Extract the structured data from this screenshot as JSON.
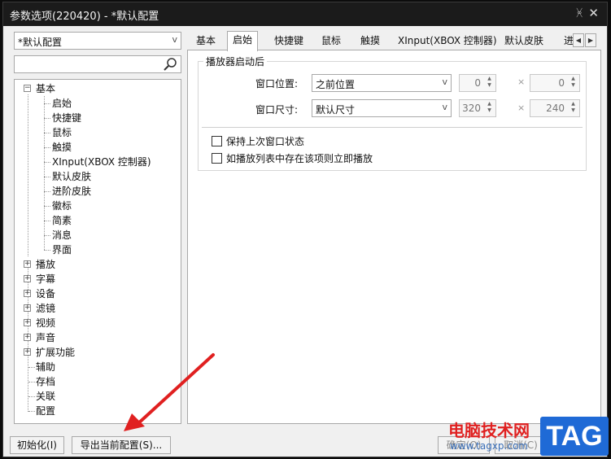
{
  "window": {
    "title": "参数选项(220420) - *默认配置",
    "pin_icon": "pin-icon",
    "close_icon": "close-icon"
  },
  "profile_combo": {
    "value": "*默认配置"
  },
  "search": {
    "value": "",
    "icon": "search-icon"
  },
  "tree": {
    "items": [
      {
        "label": "基本",
        "expander": "⊟"
      },
      {
        "label": "启始"
      },
      {
        "label": "快捷键"
      },
      {
        "label": "鼠标"
      },
      {
        "label": "触摸"
      },
      {
        "label": "XInput(XBOX 控制器)"
      },
      {
        "label": "默认皮肤"
      },
      {
        "label": "进阶皮肤"
      },
      {
        "label": "徽标"
      },
      {
        "label": "简素"
      },
      {
        "label": "消息"
      },
      {
        "label": "界面"
      },
      {
        "label": "播放",
        "expander": "⊞"
      },
      {
        "label": "字幕",
        "expander": "⊞"
      },
      {
        "label": "设备",
        "expander": "⊞"
      },
      {
        "label": "滤镜",
        "expander": "⊞"
      },
      {
        "label": "视频",
        "expander": "⊞"
      },
      {
        "label": "声音",
        "expander": "⊞"
      },
      {
        "label": "扩展功能",
        "expander": "⊞"
      },
      {
        "label": "辅助"
      },
      {
        "label": "存档"
      },
      {
        "label": "关联"
      },
      {
        "label": "配置"
      }
    ]
  },
  "tabs": [
    {
      "label": "基本"
    },
    {
      "label": "启始",
      "active": true
    },
    {
      "label": "快捷键"
    },
    {
      "label": "鼠标"
    },
    {
      "label": "触摸"
    },
    {
      "label": "XInput(XBOX 控制器)"
    },
    {
      "label": "默认皮肤"
    },
    {
      "label": "进"
    }
  ],
  "tab_scroll": {
    "left": "◀",
    "right": "▶"
  },
  "startup": {
    "group_title": "播放器启动后",
    "position_label": "窗口位置:",
    "position_value": "之前位置",
    "pos_x": "0",
    "pos_y": "0",
    "size_label": "窗口尺寸:",
    "size_value": "默认尺寸",
    "size_w": "320",
    "size_h": "240",
    "times": "×",
    "check1": "保持上次窗口状态",
    "check2": "如播放列表中存在该项则立即播放"
  },
  "buttons": {
    "init": "初始化(I)",
    "export": "导出当前配置(S)...",
    "ok": "确定(O)",
    "cancel": "取消(C)"
  },
  "watermark": {
    "site_name": "电脑技术网",
    "url": "www.tagxp.com",
    "tag": "TAG"
  },
  "colors": {
    "annotation_arrow": "#e02020",
    "title_bar": "#1b1b1b",
    "tag_badge": "#1f6ad6"
  }
}
